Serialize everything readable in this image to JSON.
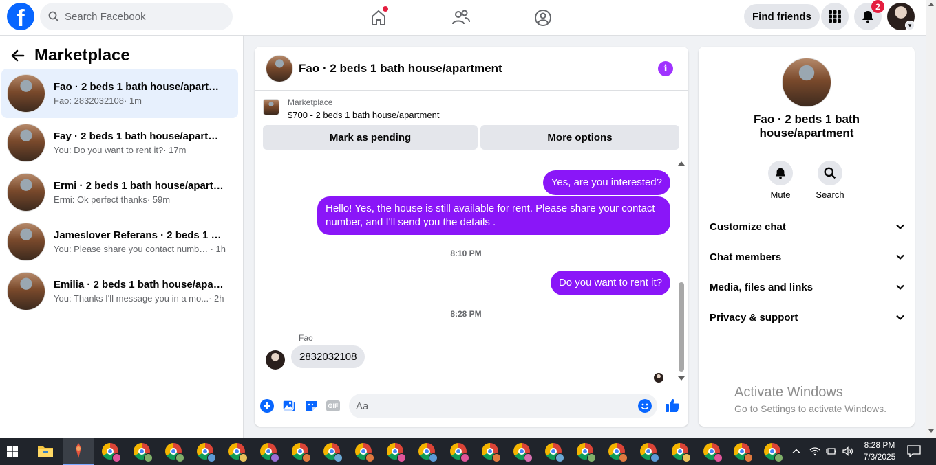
{
  "topbar": {
    "logo_letter": "f",
    "search_placeholder": "Search Facebook",
    "find_friends": "Find friends",
    "notification_count": "2"
  },
  "sidebar": {
    "title": "Marketplace",
    "conversations": [
      {
        "title": "Fao · 2 beds 1 bath house/apartme...",
        "message": "Fao: 2832032108",
        "time": "· 1m"
      },
      {
        "title": "Fay · 2 beds 1 bath house/apartment",
        "message": "You: Do you want to rent it?",
        "time": "· 17m"
      },
      {
        "title": "Ermi · 2 beds 1 bath house/apartm...",
        "message": "Ermi: Ok perfect thanks",
        "time": "· 59m"
      },
      {
        "title": "Jameslover Referans · 2 beds 1 bat...",
        "message": "You: Please share you contact number...",
        "time": "· 1h"
      },
      {
        "title": "Emilia · 2 beds 1 bath house/apart...",
        "message": "You: Thanks I'll message you in a mo...",
        "time": "· 2h"
      }
    ]
  },
  "chat": {
    "title": "Fao · 2 beds 1 bath house/apartment",
    "info_glyph": "i",
    "listing_label": "Marketplace",
    "listing_price": "$700 - 2 beds 1 bath house/apartment",
    "mark_pending": "Mark as pending",
    "more_options": "More options",
    "messages": {
      "out1": "Yes, are you interested?",
      "out2": "Hello! Yes, the house is still available for rent. Please share your contact number, and I'll send you the details .",
      "time1": "8:10 PM",
      "out3": "Do you want to rent it?",
      "time2": "8:28 PM",
      "sender": "Fao",
      "in1": "2832032108"
    },
    "composer_placeholder": "Aa",
    "gif_label": "GIF"
  },
  "details": {
    "name": "Fao · 2 beds 1 bath house/apartment",
    "mute": "Mute",
    "search": "Search",
    "rows": [
      "Customize chat",
      "Chat members",
      "Media, files and links",
      "Privacy & support"
    ],
    "activate_title": "Activate Windows",
    "activate_sub": "Go to Settings to activate Windows."
  },
  "taskbar": {
    "time": "8:28 PM",
    "date": "7/3/2025"
  },
  "colors": {
    "brand": "#0866ff",
    "bubble_out": "#8a16f8",
    "info": "#a033ff",
    "notification": "#e41e3f"
  }
}
